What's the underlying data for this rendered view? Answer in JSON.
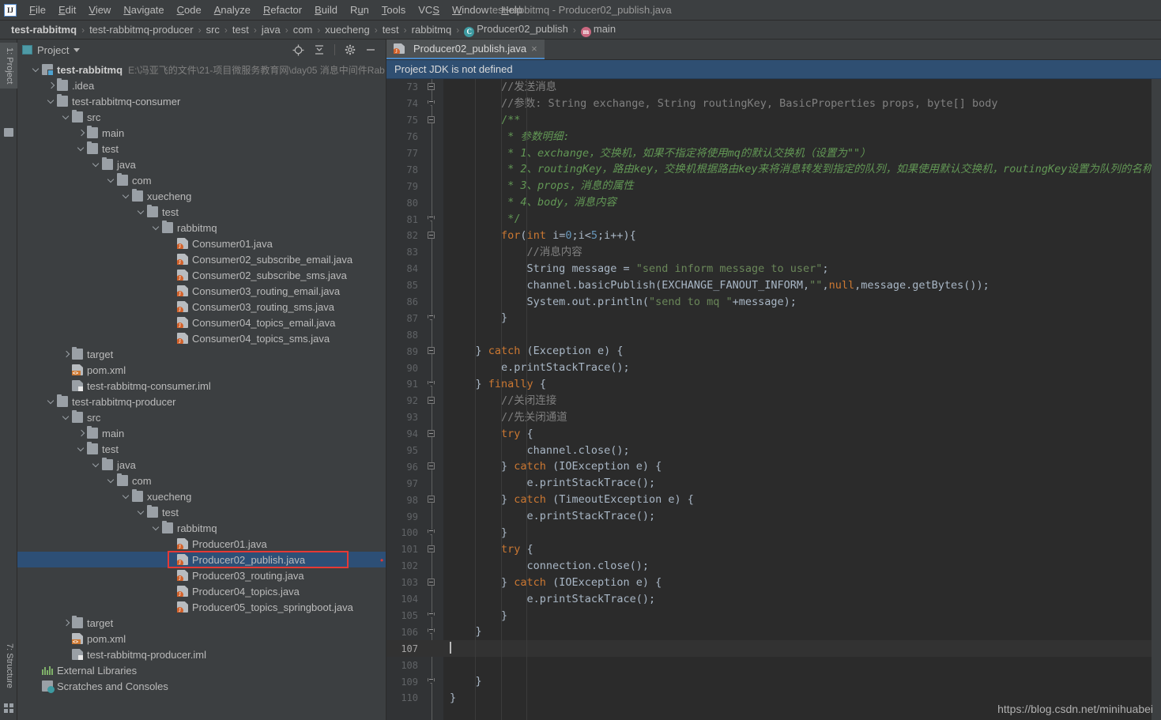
{
  "window": {
    "title": "test-rabbitmq - Producer02_publish.java",
    "logo": "ij-logo"
  },
  "menubar": {
    "items": [
      {
        "label": "File",
        "mnemonic": "F"
      },
      {
        "label": "Edit",
        "mnemonic": "E"
      },
      {
        "label": "View",
        "mnemonic": "V"
      },
      {
        "label": "Navigate",
        "mnemonic": "N"
      },
      {
        "label": "Code",
        "mnemonic": "C"
      },
      {
        "label": "Analyze",
        "mnemonic": "A"
      },
      {
        "label": "Refactor",
        "mnemonic": "R"
      },
      {
        "label": "Build",
        "mnemonic": "B"
      },
      {
        "label": "Run",
        "mnemonic": "u"
      },
      {
        "label": "Tools",
        "mnemonic": "T"
      },
      {
        "label": "VCS",
        "mnemonic": "S"
      },
      {
        "label": "Window",
        "mnemonic": "W"
      },
      {
        "label": "Help",
        "mnemonic": "H"
      }
    ]
  },
  "breadcrumb": {
    "items": [
      {
        "label": "test-rabbitmq",
        "bold": true,
        "icon": ""
      },
      {
        "label": "test-rabbitmq-producer",
        "bold": false,
        "icon": ""
      },
      {
        "label": "src",
        "bold": false,
        "icon": ""
      },
      {
        "label": "test",
        "bold": false,
        "icon": ""
      },
      {
        "label": "java",
        "bold": false,
        "icon": ""
      },
      {
        "label": "com",
        "bold": false,
        "icon": ""
      },
      {
        "label": "xuecheng",
        "bold": false,
        "icon": ""
      },
      {
        "label": "test",
        "bold": false,
        "icon": ""
      },
      {
        "label": "rabbitmq",
        "bold": false,
        "icon": ""
      },
      {
        "label": "Producer02_publish",
        "bold": false,
        "icon": "class-icon",
        "glyph": "C"
      },
      {
        "label": "main",
        "bold": false,
        "icon": "method-icon",
        "glyph": "m"
      }
    ],
    "separator": "›"
  },
  "toolwindows": {
    "left_top": "1: Project",
    "left_bottom": "7: Structure"
  },
  "project_panel": {
    "title": "Project",
    "tools": [
      {
        "name": "locate-icon",
        "tooltip": "Select Opened File"
      },
      {
        "name": "collapse-all-icon",
        "tooltip": "Collapse All"
      },
      {
        "name": "gear-icon",
        "tooltip": "Settings"
      },
      {
        "name": "minimize-icon",
        "tooltip": "Hide"
      }
    ],
    "tree": [
      {
        "depth": 0,
        "arrow": "d",
        "icon": "module-icon",
        "label": "test-rabbitmq",
        "bold": true,
        "path": "E:\\冯亚飞的文件\\21-项目微服务教育网\\day05 消息中间件Rab"
      },
      {
        "depth": 1,
        "arrow": "r",
        "icon": "folder-icon",
        "label": ".idea"
      },
      {
        "depth": 1,
        "arrow": "d",
        "icon": "folder-icon",
        "label": "test-rabbitmq-consumer"
      },
      {
        "depth": 2,
        "arrow": "d",
        "icon": "folder-icon",
        "label": "src"
      },
      {
        "depth": 3,
        "arrow": "r",
        "icon": "folder-icon",
        "label": "main"
      },
      {
        "depth": 3,
        "arrow": "d",
        "icon": "folder-icon",
        "label": "test"
      },
      {
        "depth": 4,
        "arrow": "d",
        "icon": "folder-icon",
        "label": "java"
      },
      {
        "depth": 5,
        "arrow": "d",
        "icon": "folder-icon",
        "label": "com"
      },
      {
        "depth": 6,
        "arrow": "d",
        "icon": "folder-icon",
        "label": "xuecheng"
      },
      {
        "depth": 7,
        "arrow": "d",
        "icon": "folder-icon",
        "label": "test"
      },
      {
        "depth": 8,
        "arrow": "d",
        "icon": "folder-icon",
        "label": "rabbitmq"
      },
      {
        "depth": 9,
        "arrow": "",
        "icon": "java-file-icon",
        "label": "Consumer01.java"
      },
      {
        "depth": 9,
        "arrow": "",
        "icon": "java-file-icon",
        "label": "Consumer02_subscribe_email.java"
      },
      {
        "depth": 9,
        "arrow": "",
        "icon": "java-file-icon",
        "label": "Consumer02_subscribe_sms.java"
      },
      {
        "depth": 9,
        "arrow": "",
        "icon": "java-file-icon",
        "label": "Consumer03_routing_email.java"
      },
      {
        "depth": 9,
        "arrow": "",
        "icon": "java-file-icon",
        "label": "Consumer03_routing_sms.java"
      },
      {
        "depth": 9,
        "arrow": "",
        "icon": "java-file-icon",
        "label": "Consumer04_topics_email.java"
      },
      {
        "depth": 9,
        "arrow": "",
        "icon": "java-file-icon",
        "label": "Consumer04_topics_sms.java"
      },
      {
        "depth": 2,
        "arrow": "r",
        "icon": "folder-icon",
        "label": "target"
      },
      {
        "depth": 2,
        "arrow": "",
        "icon": "xml-file-icon",
        "label": "pom.xml"
      },
      {
        "depth": 2,
        "arrow": "",
        "icon": "iml-file-icon",
        "label": "test-rabbitmq-consumer.iml"
      },
      {
        "depth": 1,
        "arrow": "d",
        "icon": "folder-icon",
        "label": "test-rabbitmq-producer"
      },
      {
        "depth": 2,
        "arrow": "d",
        "icon": "folder-icon",
        "label": "src"
      },
      {
        "depth": 3,
        "arrow": "r",
        "icon": "folder-icon",
        "label": "main"
      },
      {
        "depth": 3,
        "arrow": "d",
        "icon": "folder-icon",
        "label": "test"
      },
      {
        "depth": 4,
        "arrow": "d",
        "icon": "folder-icon",
        "label": "java"
      },
      {
        "depth": 5,
        "arrow": "d",
        "icon": "folder-icon",
        "label": "com"
      },
      {
        "depth": 6,
        "arrow": "d",
        "icon": "folder-icon",
        "label": "xuecheng"
      },
      {
        "depth": 7,
        "arrow": "d",
        "icon": "folder-icon",
        "label": "test"
      },
      {
        "depth": 8,
        "arrow": "d",
        "icon": "folder-icon",
        "label": "rabbitmq"
      },
      {
        "depth": 9,
        "arrow": "",
        "icon": "java-file-icon",
        "label": "Producer01.java"
      },
      {
        "depth": 9,
        "arrow": "",
        "icon": "java-file-icon",
        "label": "Producer02_publish.java",
        "selected": true,
        "highlighted": true
      },
      {
        "depth": 9,
        "arrow": "",
        "icon": "java-file-icon",
        "label": "Producer03_routing.java"
      },
      {
        "depth": 9,
        "arrow": "",
        "icon": "java-file-icon",
        "label": "Producer04_topics.java"
      },
      {
        "depth": 9,
        "arrow": "",
        "icon": "java-file-icon",
        "label": "Producer05_topics_springboot.java"
      },
      {
        "depth": 2,
        "arrow": "r",
        "icon": "folder-icon",
        "label": "target"
      },
      {
        "depth": 2,
        "arrow": "",
        "icon": "xml-file-icon",
        "label": "pom.xml"
      },
      {
        "depth": 2,
        "arrow": "",
        "icon": "iml-file-icon",
        "label": "test-rabbitmq-producer.iml"
      },
      {
        "depth": 0,
        "arrow": "",
        "icon": "library-icon",
        "label": "External Libraries"
      },
      {
        "depth": 0,
        "arrow": "",
        "icon": "scratch-icon",
        "label": "Scratches and Consoles"
      }
    ]
  },
  "editor": {
    "tab": {
      "label": "Producer02_publish.java",
      "icon": "java-file-icon",
      "close": "×"
    },
    "notification": "Project JDK is not defined",
    "watermark": "https://blog.csdn.net/minihuabei",
    "first_line": 73,
    "current_line": 107,
    "lines": [
      {
        "n": 73,
        "fold": "start",
        "indent": 2,
        "tokens": [
          {
            "t": "cmt",
            "s": "//发送消息"
          }
        ]
      },
      {
        "n": 74,
        "fold": "end",
        "indent": 2,
        "tokens": [
          {
            "t": "cmt",
            "s": "//参数: String exchange, String routingKey, BasicProperties props, byte[] body"
          }
        ]
      },
      {
        "n": 75,
        "fold": "start",
        "indent": 2,
        "tokens": [
          {
            "t": "docp",
            "s": "/**"
          }
        ]
      },
      {
        "n": 76,
        "fold": "",
        "indent": 2,
        "tokens": [
          {
            "t": "docp",
            "s": " * "
          },
          {
            "t": "doc",
            "s": "参数明细:"
          }
        ]
      },
      {
        "n": 77,
        "fold": "",
        "indent": 2,
        "tokens": [
          {
            "t": "docp",
            "s": " * "
          },
          {
            "t": "doc",
            "s": "1、exchange，交换机，如果不指定将使用mq的默认交换机（设置为\"\"）"
          }
        ]
      },
      {
        "n": 78,
        "fold": "",
        "indent": 2,
        "tokens": [
          {
            "t": "docp",
            "s": " * "
          },
          {
            "t": "doc",
            "s": "2、routingKey，路由key，交换机根据路由key来将消息转发到指定的队列，如果使用默认交换机，routingKey设置为队列的名称"
          }
        ]
      },
      {
        "n": 79,
        "fold": "",
        "indent": 2,
        "tokens": [
          {
            "t": "docp",
            "s": " * "
          },
          {
            "t": "doc",
            "s": "3、props，消息的属性"
          }
        ]
      },
      {
        "n": 80,
        "fold": "",
        "indent": 2,
        "tokens": [
          {
            "t": "docp",
            "s": " * "
          },
          {
            "t": "doc",
            "s": "4、body，消息内容"
          }
        ]
      },
      {
        "n": 81,
        "fold": "end",
        "indent": 2,
        "tokens": [
          {
            "t": "docp",
            "s": " */"
          }
        ]
      },
      {
        "n": 82,
        "fold": "start",
        "indent": 2,
        "tokens": [
          {
            "t": "kw",
            "s": "for"
          },
          {
            "t": "",
            "s": "("
          },
          {
            "t": "kw",
            "s": "int"
          },
          {
            "t": "",
            "s": " i="
          },
          {
            "t": "num",
            "s": "0"
          },
          {
            "t": "",
            "s": ";i<"
          },
          {
            "t": "num",
            "s": "5"
          },
          {
            "t": "",
            "s": ";i++){"
          }
        ]
      },
      {
        "n": 83,
        "fold": "",
        "indent": 3,
        "tokens": [
          {
            "t": "cmt",
            "s": "//消息内容"
          }
        ]
      },
      {
        "n": 84,
        "fold": "",
        "indent": 3,
        "tokens": [
          {
            "t": "",
            "s": "String message = "
          },
          {
            "t": "str",
            "s": "\"send inform message to user\""
          },
          {
            "t": "",
            "s": ";"
          }
        ]
      },
      {
        "n": 85,
        "fold": "",
        "indent": 3,
        "tokens": [
          {
            "t": "",
            "s": "channel.basicPublish(EXCHANGE_FANOUT_INFORM,"
          },
          {
            "t": "str",
            "s": "\"\""
          },
          {
            "t": "",
            "s": ","
          },
          {
            "t": "kw",
            "s": "null"
          },
          {
            "t": "",
            "s": ",message.getBytes());"
          }
        ]
      },
      {
        "n": 86,
        "fold": "",
        "indent": 3,
        "tokens": [
          {
            "t": "",
            "s": "System.out.println("
          },
          {
            "t": "str",
            "s": "\"send to mq \""
          },
          {
            "t": "",
            "s": "+message);"
          }
        ]
      },
      {
        "n": 87,
        "fold": "end",
        "indent": 2,
        "tokens": [
          {
            "t": "",
            "s": "}"
          }
        ]
      },
      {
        "n": 88,
        "fold": "",
        "indent": 0,
        "tokens": []
      },
      {
        "n": 89,
        "fold": "start",
        "indent": 1,
        "tokens": [
          {
            "t": "",
            "s": "} "
          },
          {
            "t": "kw",
            "s": "catch"
          },
          {
            "t": "",
            "s": " (Exception e) {"
          }
        ]
      },
      {
        "n": 90,
        "fold": "",
        "indent": 2,
        "tokens": [
          {
            "t": "",
            "s": "e.printStackTrace();"
          }
        ]
      },
      {
        "n": 91,
        "fold": "end",
        "indent": 1,
        "tokens": [
          {
            "t": "",
            "s": "} "
          },
          {
            "t": "kw",
            "s": "finally"
          },
          {
            "t": "",
            "s": " {"
          }
        ]
      },
      {
        "n": 92,
        "fold": "start",
        "indent": 2,
        "tokens": [
          {
            "t": "cmt",
            "s": "//关闭连接"
          }
        ]
      },
      {
        "n": 93,
        "fold": "",
        "indent": 2,
        "tokens": [
          {
            "t": "cmt",
            "s": "//先关闭通道"
          }
        ]
      },
      {
        "n": 94,
        "fold": "start",
        "indent": 2,
        "tokens": [
          {
            "t": "kw",
            "s": "try"
          },
          {
            "t": "",
            "s": " {"
          }
        ]
      },
      {
        "n": 95,
        "fold": "",
        "indent": 3,
        "tokens": [
          {
            "t": "",
            "s": "channel.close();"
          }
        ]
      },
      {
        "n": 96,
        "fold": "start",
        "indent": 2,
        "tokens": [
          {
            "t": "",
            "s": "} "
          },
          {
            "t": "kw",
            "s": "catch"
          },
          {
            "t": "",
            "s": " (IOException e) {"
          }
        ]
      },
      {
        "n": 97,
        "fold": "",
        "indent": 3,
        "tokens": [
          {
            "t": "",
            "s": "e.printStackTrace();"
          }
        ]
      },
      {
        "n": 98,
        "fold": "start",
        "indent": 2,
        "tokens": [
          {
            "t": "",
            "s": "} "
          },
          {
            "t": "kw",
            "s": "catch"
          },
          {
            "t": "",
            "s": " (TimeoutException e) {"
          }
        ]
      },
      {
        "n": 99,
        "fold": "",
        "indent": 3,
        "tokens": [
          {
            "t": "",
            "s": "e.printStackTrace();"
          }
        ]
      },
      {
        "n": 100,
        "fold": "end",
        "indent": 2,
        "tokens": [
          {
            "t": "",
            "s": "}"
          }
        ]
      },
      {
        "n": 101,
        "fold": "start",
        "indent": 2,
        "tokens": [
          {
            "t": "kw",
            "s": "try"
          },
          {
            "t": "",
            "s": " {"
          }
        ]
      },
      {
        "n": 102,
        "fold": "",
        "indent": 3,
        "tokens": [
          {
            "t": "",
            "s": "connection.close();"
          }
        ]
      },
      {
        "n": 103,
        "fold": "start",
        "indent": 2,
        "tokens": [
          {
            "t": "",
            "s": "} "
          },
          {
            "t": "kw",
            "s": "catch"
          },
          {
            "t": "",
            "s": " (IOException e) {"
          }
        ]
      },
      {
        "n": 104,
        "fold": "",
        "indent": 3,
        "tokens": [
          {
            "t": "",
            "s": "e.printStackTrace();"
          }
        ]
      },
      {
        "n": 105,
        "fold": "end",
        "indent": 2,
        "tokens": [
          {
            "t": "",
            "s": "}"
          }
        ]
      },
      {
        "n": 106,
        "fold": "end",
        "indent": 1,
        "tokens": [
          {
            "t": "",
            "s": "}"
          }
        ]
      },
      {
        "n": 107,
        "fold": "",
        "indent": 0,
        "tokens": [],
        "cursor": true,
        "current": true
      },
      {
        "n": 108,
        "fold": "",
        "indent": 0,
        "tokens": []
      },
      {
        "n": 109,
        "fold": "end",
        "indent": 1,
        "tokens": [
          {
            "t": "",
            "s": "}"
          }
        ]
      },
      {
        "n": 110,
        "fold": "",
        "indent": 0,
        "tokens": [
          {
            "t": "",
            "s": "}"
          }
        ]
      }
    ]
  },
  "colors": {
    "bg_panel": "#3c3f41",
    "bg_editor": "#2b2b2b",
    "gutter": "#313335",
    "accent_tab": "#4a88c7",
    "notif_bg": "#2f4f72",
    "selection": "#2d4f76",
    "highlight_box": "#e53935",
    "keyword": "#cc7832",
    "string": "#6a8759",
    "comment": "#808080",
    "javadoc": "#629755",
    "number": "#6897bb"
  }
}
